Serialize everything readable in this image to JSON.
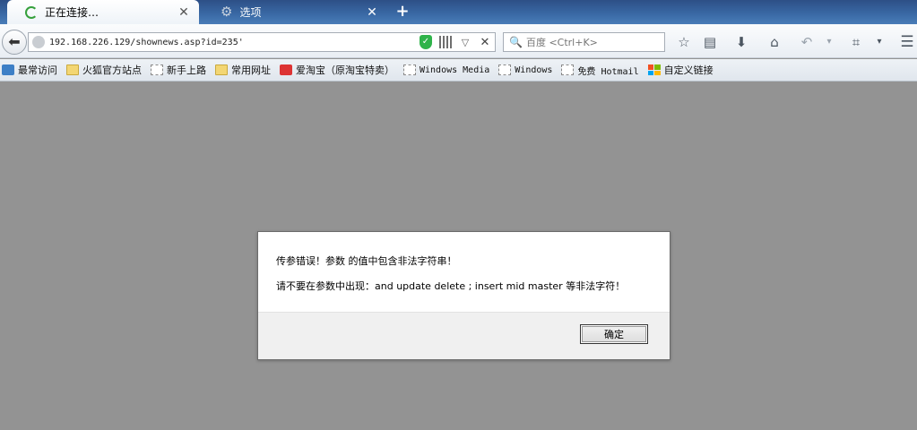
{
  "tabs": [
    {
      "title": "正在连接…",
      "state": "loading"
    },
    {
      "title": "选项",
      "state": "inactive"
    }
  ],
  "navbar": {
    "url": "192.168.226.129/shownews.asp?id=235'",
    "search_placeholder": "百度 <Ctrl+K>"
  },
  "bookmarks": [
    {
      "label": "最常访问",
      "icon": "most-visited-icon"
    },
    {
      "label": "火狐官方站点",
      "icon": "folder-icon"
    },
    {
      "label": "新手上路",
      "icon": "page-icon"
    },
    {
      "label": "常用网址",
      "icon": "folder-icon"
    },
    {
      "label": "爱淘宝（原淘宝特卖）",
      "icon": "taobao-icon"
    },
    {
      "label": "Windows Media",
      "icon": "page-icon"
    },
    {
      "label": "Windows",
      "icon": "page-icon"
    },
    {
      "label": "免费 Hotmail",
      "icon": "page-icon"
    },
    {
      "label": "自定义链接",
      "icon": "windows-logo-icon"
    }
  ],
  "dialog": {
    "line1": "传参错误！参数  的值中包含非法字符串！",
    "line2": "请不要在参数中出现：and update delete ; insert mid master 等非法字符！",
    "ok_label": "确定"
  },
  "colors": {
    "tab_strip": "#3a6aa6",
    "content_bg": "#939393",
    "shield_green": "#2fb34a"
  }
}
